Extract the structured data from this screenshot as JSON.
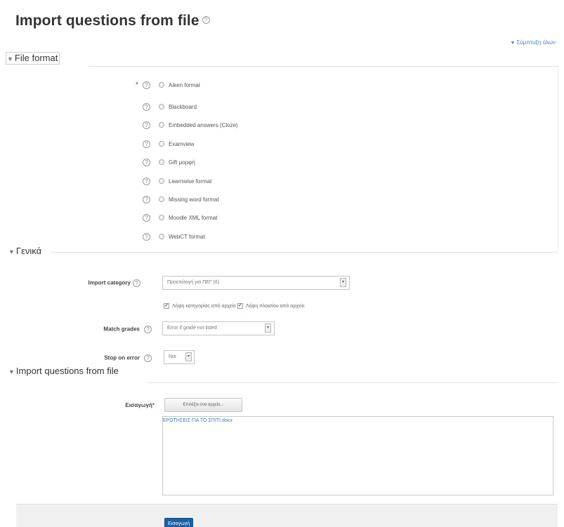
{
  "page": {
    "title": "Import questions from file",
    "collapse_all": "Σύμπτυξη όλων"
  },
  "file_format": {
    "legend": "File format",
    "options": [
      {
        "label": "Aiken format"
      },
      {
        "label": "Blackboard"
      },
      {
        "label": "Embedded answers (Cloze)"
      },
      {
        "label": "Examview"
      },
      {
        "label": "Gift μορφή"
      },
      {
        "label": "Learnwise format"
      },
      {
        "label": "Missing word format"
      },
      {
        "label": "Moodle XML format"
      },
      {
        "label": "WebCT format"
      }
    ]
  },
  "general": {
    "legend": "Γενικά",
    "import_category_label": "Import category",
    "import_category_value": "Προεπιλογή για ΠΕΓ (6)",
    "category_from_file_label": "Λήψη κατηγορίας από αρχείο",
    "context_from_file_label": "Λήψη πλαισίου από αρχείο",
    "match_grades_label": "Match grades",
    "match_grades_value": "Error if grade not listed",
    "stop_on_error_label": "Stop on error",
    "stop_on_error_value": "Ναι"
  },
  "import_section": {
    "legend": "Import questions from file",
    "import_label": "Εισαγωγή",
    "choose_file_button": "Επιλέξτε ένα αρχείο...",
    "file_name": "ΕΡΩΤΗΣΕΙΣ ΓΙΑ ΤΟ ΣΠΙΤΙ.docx"
  },
  "footer": {
    "submit_button": "Εισαγωγή"
  },
  "icons": {
    "help": "?",
    "collapse_caret": "▼",
    "legend_toggle": "▼",
    "select_arrow": "▾",
    "check_mark": "✓",
    "required_star": "*"
  },
  "colors": {
    "link": "#4a7fb5",
    "primary_button": "#1b5fa5",
    "required": "#c94040",
    "footer_bg": "#f0f0f0"
  }
}
